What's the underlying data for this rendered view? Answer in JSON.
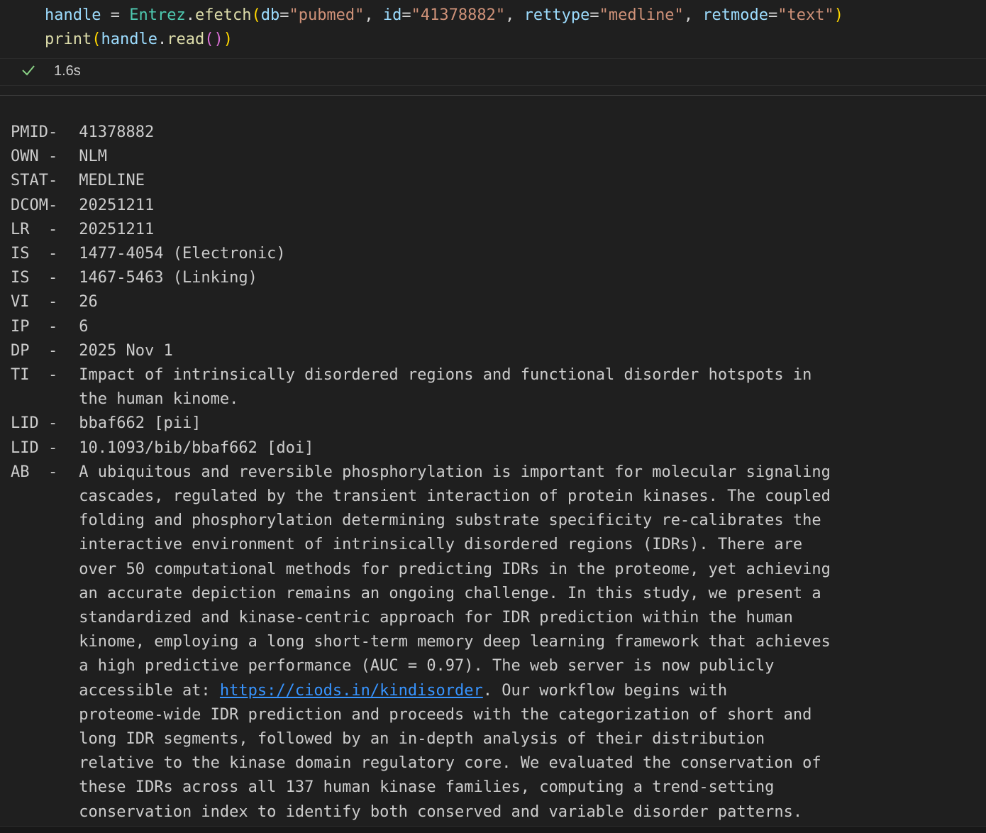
{
  "code": {
    "line1": {
      "var": "handle",
      "eq": " = ",
      "cls": "Entrez",
      "dot": ".",
      "fn": "efetch",
      "p_open": "(",
      "k1": "db",
      "v1": "\"pubmed\"",
      "k2": "id",
      "v2": "\"41378882\"",
      "k3": "rettype",
      "v3": "\"medline\"",
      "k4": "retmode",
      "v4": "\"text\"",
      "p_close": ")"
    },
    "line2": {
      "fn": "print",
      "p_open": "(",
      "var": "handle",
      "dot": ".",
      "method": "read",
      "inner": "()",
      "p_close": ")"
    }
  },
  "status": {
    "duration": "1.6s",
    "icon": "check-icon"
  },
  "output": {
    "lines": [
      {
        "field": "PMID-",
        "text": " 41378882"
      },
      {
        "field": "OWN -",
        "text": " NLM"
      },
      {
        "field": "STAT-",
        "text": " MEDLINE"
      },
      {
        "field": "DCOM-",
        "text": " 20251211"
      },
      {
        "field": "LR  -",
        "text": " 20251211"
      },
      {
        "field": "IS  -",
        "text": " 1477-4054 (Electronic)"
      },
      {
        "field": "IS  -",
        "text": " 1467-5463 (Linking)"
      },
      {
        "field": "VI  -",
        "text": " 26"
      },
      {
        "field": "IP  -",
        "text": " 6"
      },
      {
        "field": "DP  -",
        "text": " 2025 Nov 1"
      },
      {
        "field": "TI  -",
        "text": " Impact of intrinsically disordered regions and functional disorder hotspots in"
      },
      {
        "field": "",
        "text": " the human kinome."
      },
      {
        "field": "LID -",
        "text": " bbaf662 [pii]"
      },
      {
        "field": "LID -",
        "text": " 10.1093/bib/bbaf662 [doi]"
      },
      {
        "field": "AB  -",
        "text": " A ubiquitous and reversible phosphorylation is important for molecular signaling"
      },
      {
        "field": "",
        "text": " cascades, regulated by the transient interaction of protein kinases. The coupled"
      },
      {
        "field": "",
        "text": " folding and phosphorylation determining substrate specificity re-calibrates the"
      },
      {
        "field": "",
        "text": " interactive environment of intrinsically disordered regions (IDRs). There are"
      },
      {
        "field": "",
        "text": " over 50 computational methods for predicting IDRs in the proteome, yet achieving"
      },
      {
        "field": "",
        "text": " an accurate depiction remains an ongoing challenge. In this study, we present a"
      },
      {
        "field": "",
        "text": " standardized and kinase-centric approach for IDR prediction within the human"
      },
      {
        "field": "",
        "text": " kinome, employing a long short-term memory deep learning framework that achieves"
      },
      {
        "field": "",
        "text": " a high predictive performance (AUC = 0.97). The web server is now publicly"
      }
    ],
    "link_line": {
      "before": " accessible at: ",
      "link": "https://ciods.in/kindisorder",
      "after": ". Our workflow begins with"
    },
    "tail_lines": [
      " proteome-wide IDR prediction and proceeds with the categorization of short and",
      " long IDR segments, followed by an in-depth analysis of their distribution",
      " relative to the kinase domain regulatory core. We evaluated the conservation of",
      " these IDRs across all 137 human kinase families, computing a trend-setting",
      " conservation index to identify both conserved and variable disorder patterns."
    ]
  }
}
